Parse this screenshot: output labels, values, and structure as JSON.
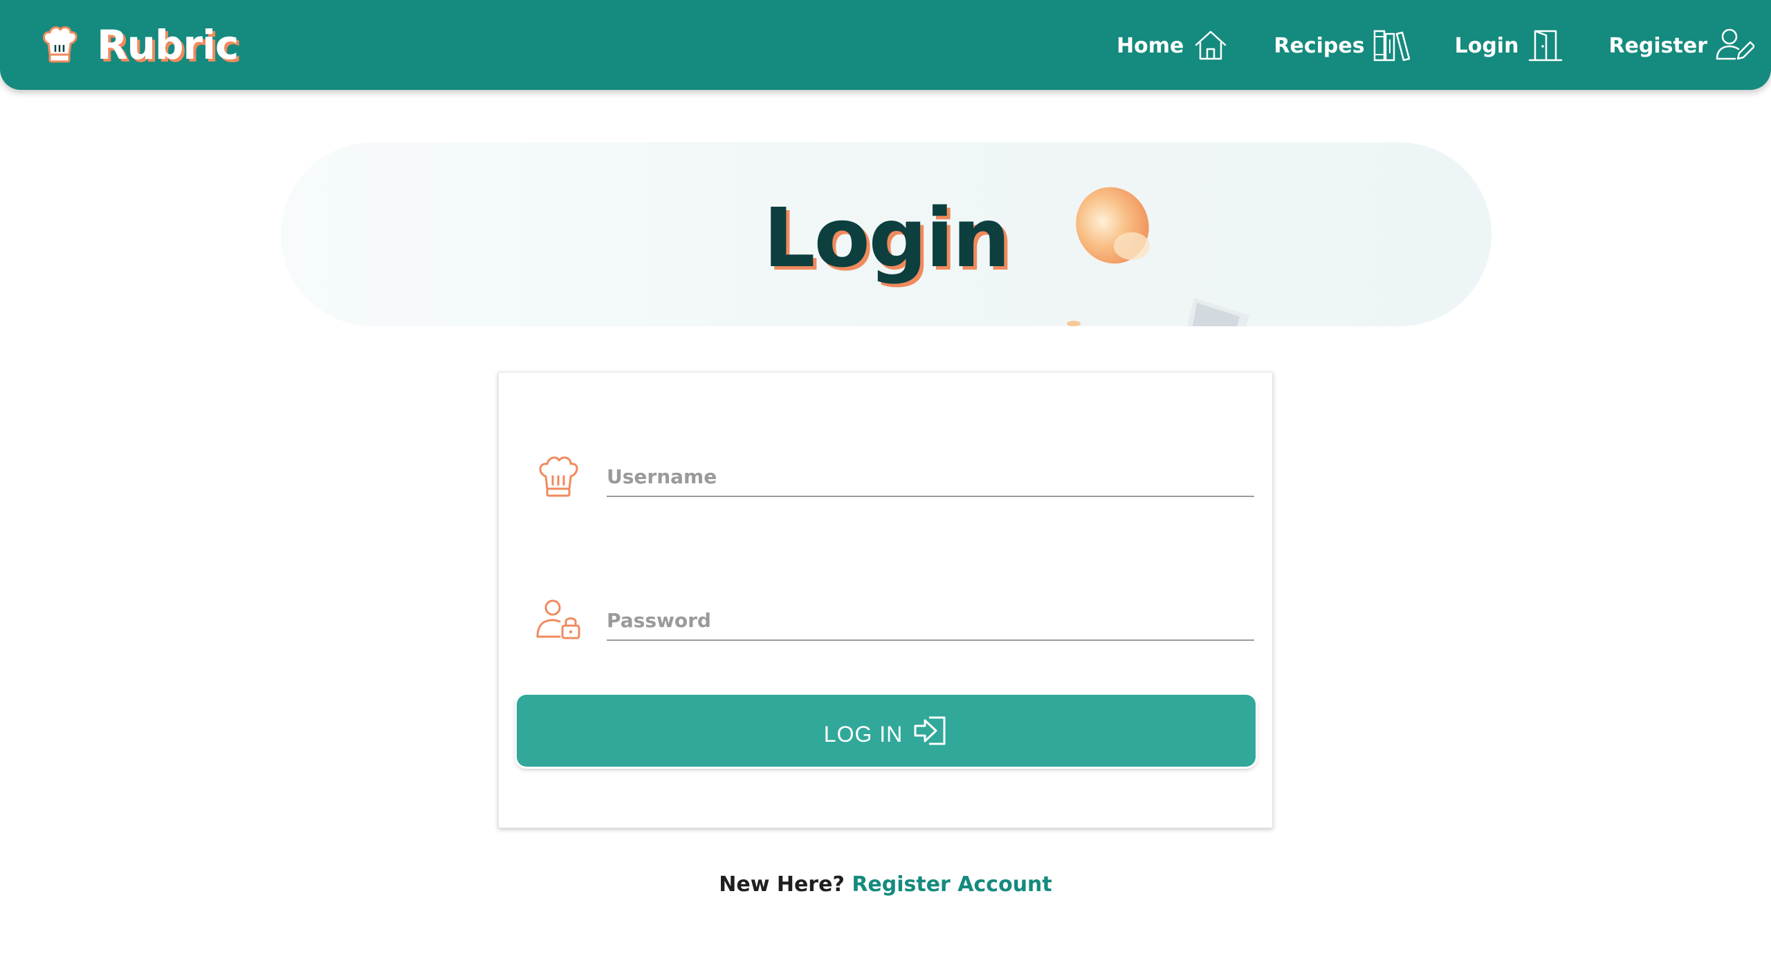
{
  "nav": {
    "brand": "Rubric",
    "items": [
      {
        "label": "Home",
        "icon": "home-icon"
      },
      {
        "label": "Recipes",
        "icon": "books-icon"
      },
      {
        "label": "Login",
        "icon": "door-icon"
      },
      {
        "label": "Register",
        "icon": "user-edit-icon"
      }
    ]
  },
  "hero": {
    "title": "Login"
  },
  "form": {
    "username": {
      "placeholder": "Username",
      "value": "",
      "icon": "chef-hat-icon"
    },
    "password": {
      "placeholder": "Password",
      "value": "",
      "icon": "user-lock-icon"
    },
    "submit": {
      "label": "LOG IN",
      "icon": "login-arrow-icon"
    }
  },
  "register": {
    "prompt": "New Here?",
    "link": "Register Account"
  },
  "colors": {
    "primary": "#158a7e",
    "button": "#31a89a",
    "accent": "#f08a5d",
    "title": "#0d3f3f"
  }
}
